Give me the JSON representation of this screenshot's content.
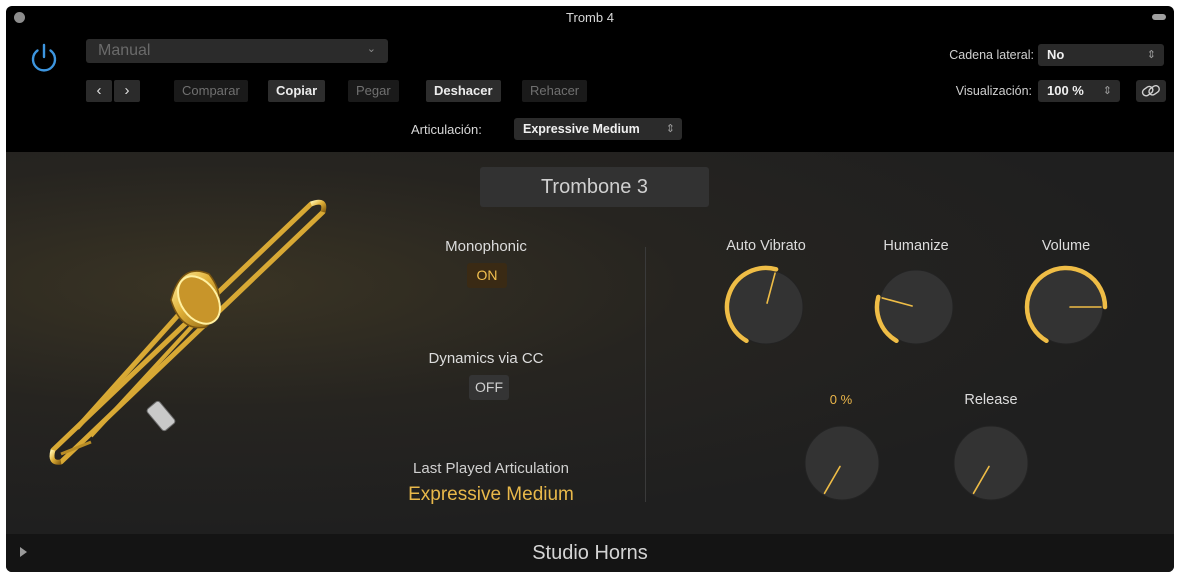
{
  "window": {
    "title": "Tromb 4"
  },
  "header": {
    "preset": "Manual",
    "buttons": {
      "compare": "Comparar",
      "copy": "Copiar",
      "paste": "Pegar",
      "undo": "Deshacer",
      "redo": "Rehacer"
    },
    "sidechain_label": "Cadena lateral:",
    "sidechain_value": "No",
    "view_label": "Visualización:",
    "view_value": "100 %",
    "articulation_label": "Articulación:",
    "articulation_value": "Expressive Medium"
  },
  "instrument": {
    "name": "Trombone 3",
    "monophonic": {
      "label": "Monophonic",
      "value": "ON"
    },
    "dynamics": {
      "label": "Dynamics via CC",
      "value": "OFF"
    },
    "last_played": {
      "label": "Last Played Articulation",
      "value": "Expressive Medium"
    },
    "knobs": {
      "auto_vibrato": {
        "label": "Auto Vibrato",
        "level": 0.55
      },
      "humanize": {
        "label": "Humanize",
        "level": 0.25
      },
      "volume": {
        "label": "Volume",
        "level": 0.8
      },
      "pitch": {
        "label": "0 %",
        "level": 0.0
      },
      "release": {
        "label": "Release",
        "level": 0.0
      }
    }
  },
  "footer": {
    "title": "Studio Horns"
  },
  "colors": {
    "accent": "#efbd46",
    "panel": "#252422",
    "header": "#000000",
    "toggle_on_text": "#f2c04f"
  },
  "icons": [
    "power-icon",
    "chevron-left-icon",
    "chevron-right-icon",
    "link-icon",
    "disclosure-triangle-icon"
  ]
}
